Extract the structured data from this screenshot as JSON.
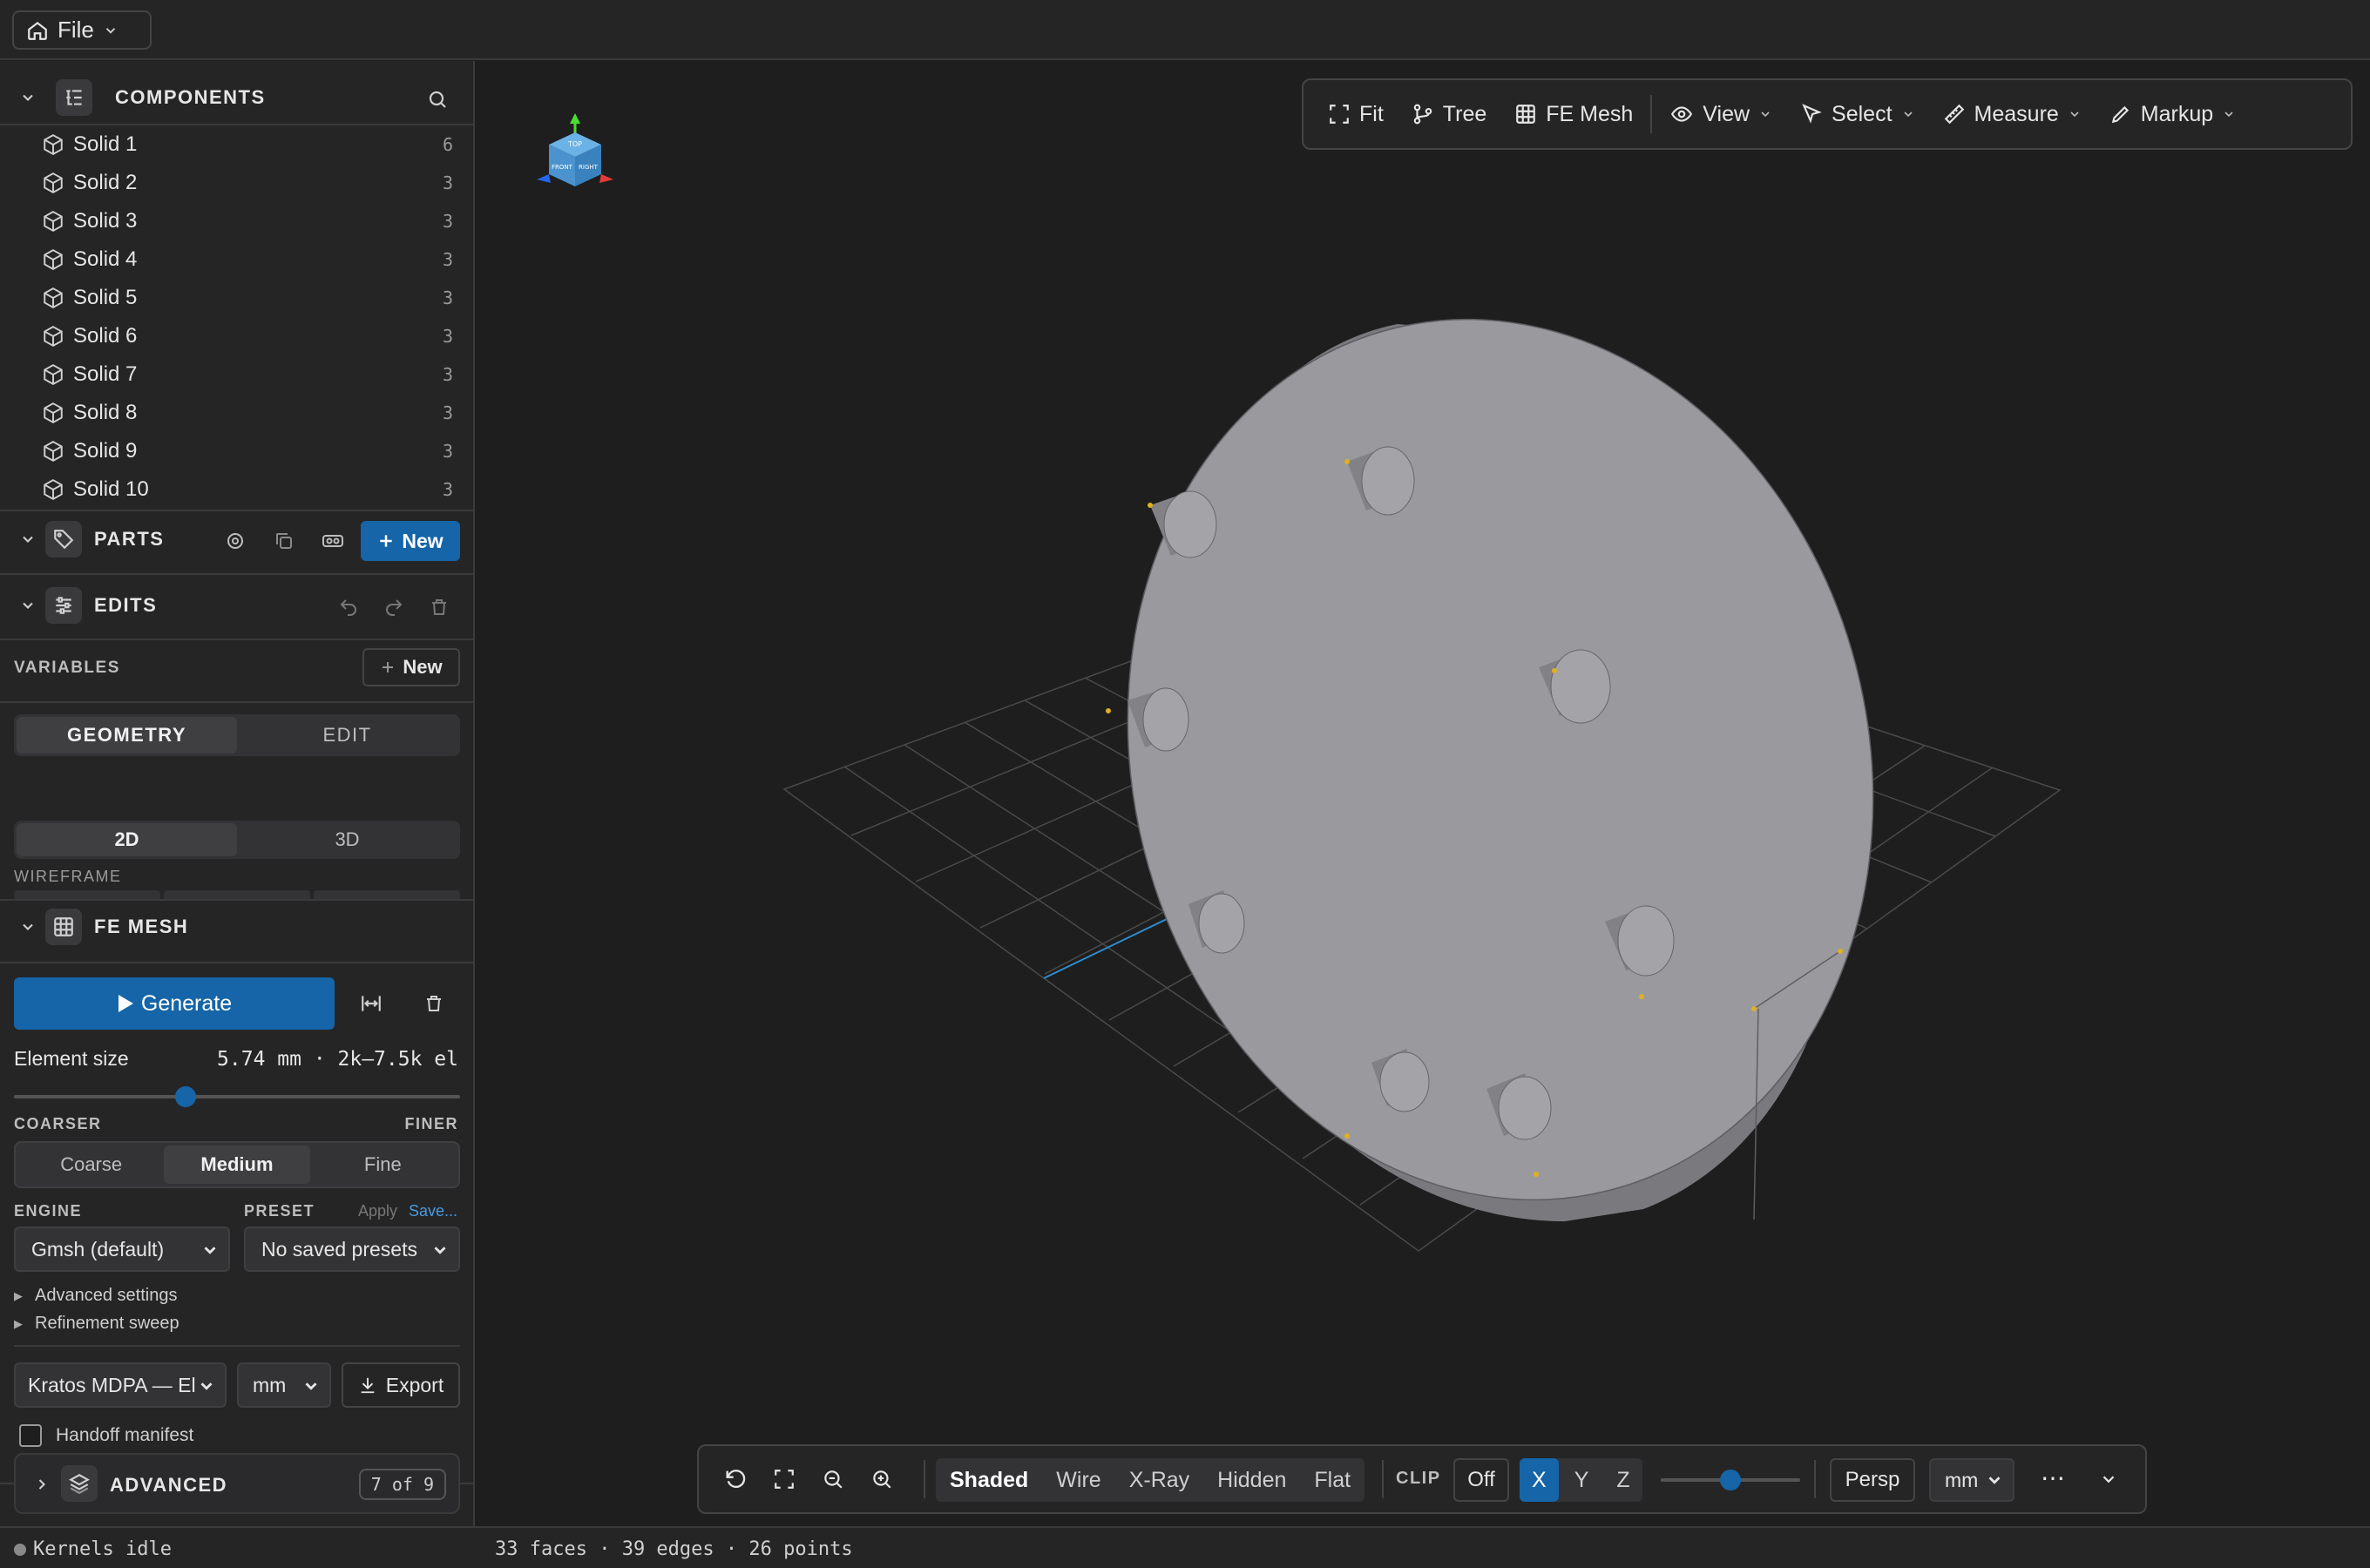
{
  "topbar": {
    "file_label": "File"
  },
  "components": {
    "title": "COMPONENTS",
    "items": [
      {
        "label": "Solid 1",
        "count": "6"
      },
      {
        "label": "Solid 2",
        "count": "3"
      },
      {
        "label": "Solid 3",
        "count": "3"
      },
      {
        "label": "Solid 4",
        "count": "3"
      },
      {
        "label": "Solid 5",
        "count": "3"
      },
      {
        "label": "Solid 6",
        "count": "3"
      },
      {
        "label": "Solid 7",
        "count": "3"
      },
      {
        "label": "Solid 8",
        "count": "3"
      },
      {
        "label": "Solid 9",
        "count": "3"
      },
      {
        "label": "Solid 10",
        "count": "3"
      }
    ]
  },
  "parts": {
    "title": "PARTS",
    "new_label": "New"
  },
  "edits": {
    "title": "EDITS",
    "variables_label": "VARIABLES",
    "variables_new": "New",
    "mode_tabs": [
      "GEOMETRY",
      "EDIT"
    ],
    "dim_tabs": [
      "2D",
      "3D"
    ],
    "wireframe_label": "WIREFRAME"
  },
  "femesh": {
    "title": "FE MESH",
    "generate_label": "Generate",
    "element_size_label": "Element size",
    "element_size_value": "5.74 mm · 2k–7.5k el",
    "slider_fraction": 0.384,
    "coarser": "COARSER",
    "finer": "FINER",
    "density_options": [
      "Coarse",
      "Medium",
      "Fine"
    ],
    "density_selected": "Medium",
    "engine_label": "ENGINE",
    "engine_value": "Gmsh (default)",
    "preset_label": "PRESET",
    "preset_apply": "Apply",
    "preset_save": "Save...",
    "preset_value": "No saved presets",
    "advanced_settings": "Advanced settings",
    "refinement_sweep": "Refinement sweep",
    "export_format": "Kratos MDPA — El",
    "export_unit": "mm",
    "export_label": "Export",
    "handoff_label": "Handoff manifest"
  },
  "advanced": {
    "title": "ADVANCED",
    "badge": "7 of 9"
  },
  "viewport_toolbar": [
    "Fit",
    "Tree",
    "FE Mesh",
    "View",
    "Select",
    "Measure",
    "Markup"
  ],
  "view_cube": {
    "top": "TOP",
    "front": "FRONT",
    "right": "RIGHT"
  },
  "bottom_toolbar": {
    "render_modes": [
      "Shaded",
      "Wire",
      "X-Ray",
      "Hidden",
      "Flat"
    ],
    "render_selected": "Shaded",
    "clip_label": "CLIP",
    "clip_off": "Off",
    "axes": [
      "X",
      "Y",
      "Z"
    ],
    "axis_selected": "X",
    "clip_fraction": 0.5,
    "projection": "Persp",
    "unit": "mm",
    "more": "⋯"
  },
  "status": {
    "left": "Kernels idle",
    "right": "33 faces · 39 edges · 26 points"
  },
  "colors": {
    "accent": "#1565a8",
    "background": "#1e1e1e",
    "panel": "#252526",
    "part": "#9a9a9e"
  }
}
